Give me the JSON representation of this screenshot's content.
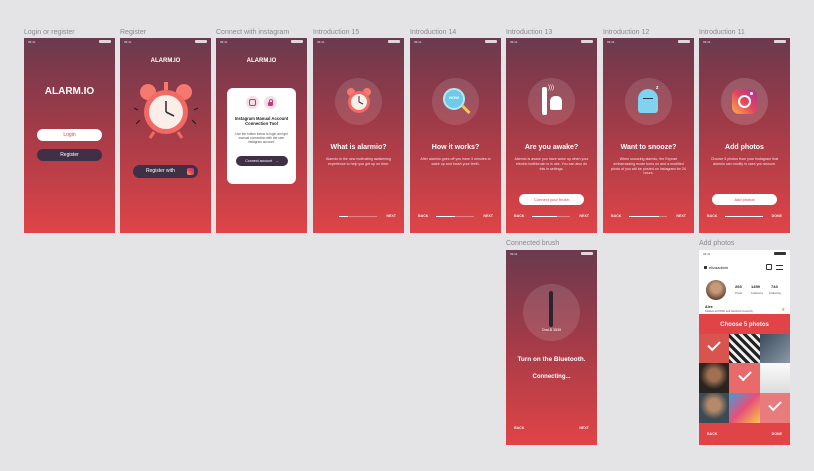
{
  "frames": [
    {
      "title": "Login or register"
    },
    {
      "title": "Register"
    },
    {
      "title": "Connect with instagram"
    },
    {
      "title": "Introduction 15"
    },
    {
      "title": "Introduction 14"
    },
    {
      "title": "Introduction 13"
    },
    {
      "title": "Introduction 12"
    },
    {
      "title": "Introduction 11"
    },
    {
      "title": "Connected brush"
    },
    {
      "title": "Add photos"
    }
  ],
  "status_time": "09:41",
  "login": {
    "logo": "ALARM.IO",
    "login_label": "Login",
    "register_label": "Register"
  },
  "register": {
    "logo": "ALARM.IO",
    "register_with_label": "Register with"
  },
  "connect": {
    "logo": "ALARM.IO",
    "card_title": "Instagram Manual Account Connection Tool",
    "card_desc": "Use the button below to login and get manual connection with the user instagram account.",
    "connect_label": "Connect account"
  },
  "intro15": {
    "title": "What is alarmio?",
    "desc": "Alarmio is the new motivating awakening experience to help you get up on time.",
    "next": "NEXT",
    "progress": 0.25
  },
  "intro14": {
    "title": "How it works?",
    "desc": "After alarmio goes off you have 3 minutes to wake up and brush your teeth.",
    "back": "BACK",
    "next": "NEXT",
    "progress": 0.5,
    "badge": "NOW"
  },
  "intro13": {
    "title": "Are you awake?",
    "desc": "Alarmio is aware you have woke up when your electric toothbrush is in use. You can also do this in settings.",
    "connect_label": "Connect your brush",
    "back": "BACK",
    "next": "NEXT",
    "progress": 0.65
  },
  "intro12": {
    "title": "Want to snooze?",
    "desc": "When snoozing alarmio, the Expose embarrassing mode turns on and a modified photo of you will be posted on Instagram for 24 hours.",
    "back": "BACK",
    "next": "NEXT",
    "progress": 0.8
  },
  "intro11": {
    "title": "Add photos",
    "desc": "Choose 5 photos from your Instagram that alarmio can modify in case you snooze.",
    "add_label": "Add photos",
    "back": "BACK",
    "next": "DONE",
    "progress": 1.0
  },
  "brush": {
    "device": "Oral-B 3535",
    "title": "Turn on the Bluetooth.",
    "status": "Connecting...",
    "back": "BACK",
    "next": "NEXT"
  },
  "photos": {
    "username": "elizaadmin",
    "posts": "265",
    "posts_label": "Posts",
    "followers": "1459",
    "followers_label": "Followers",
    "following": "743",
    "following_label": "Following",
    "name": "Alex",
    "bio": "Student at PWSK and Stanford University",
    "choose": "Choose 5 photos",
    "back": "BACK",
    "next": "DONE"
  }
}
